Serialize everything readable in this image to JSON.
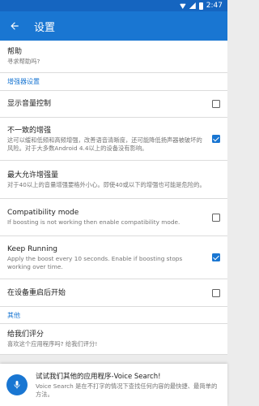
{
  "status_bar": {
    "time": "2:47"
  },
  "app_bar": {
    "title": "设置"
  },
  "rows": [
    {
      "id": "help",
      "title": "帮助",
      "summary": "寻求帮助吗?"
    },
    {
      "id": "section-enhancer",
      "section": "增强器设置"
    },
    {
      "id": "volume-control",
      "title": "显示音量控制",
      "checkbox": false
    },
    {
      "id": "inconsistent-boost",
      "title": "不一致的增强",
      "summary": "这可以缓和低频和高频增强，改善语音清晰度，还可能降低扬声器被破坏的风险。对于大多数Android 4.4以上的设备没有影响。",
      "checkbox": true
    },
    {
      "id": "max-boost",
      "title": "最大允许增强量",
      "summary": "对于40以上的音量增强要格外小心。即使40或以下的增强也可能是危险的。"
    },
    {
      "id": "compat-mode",
      "title": "Compatibility mode",
      "summary": "If boosting is not working then enable compatibility mode.",
      "checkbox": false
    },
    {
      "id": "keep-running",
      "title": "Keep Running",
      "summary": "Apply the boost every 10 seconds. Enable if boosting stops working over time.",
      "checkbox": true
    },
    {
      "id": "start-on-boot",
      "title": "在设备重启后开始",
      "checkbox": false
    },
    {
      "id": "section-other",
      "section": "其他"
    },
    {
      "id": "rate-us",
      "title": "给我们评分",
      "summary": "喜欢这个应用程序吗? 给我们评分!"
    }
  ],
  "promo": {
    "title": "试试我们其他的应用程序-Voice Search!",
    "desc": "Voice Search 是在不打字的情况下查找任何内容的最快捷、最简单的方法。"
  }
}
